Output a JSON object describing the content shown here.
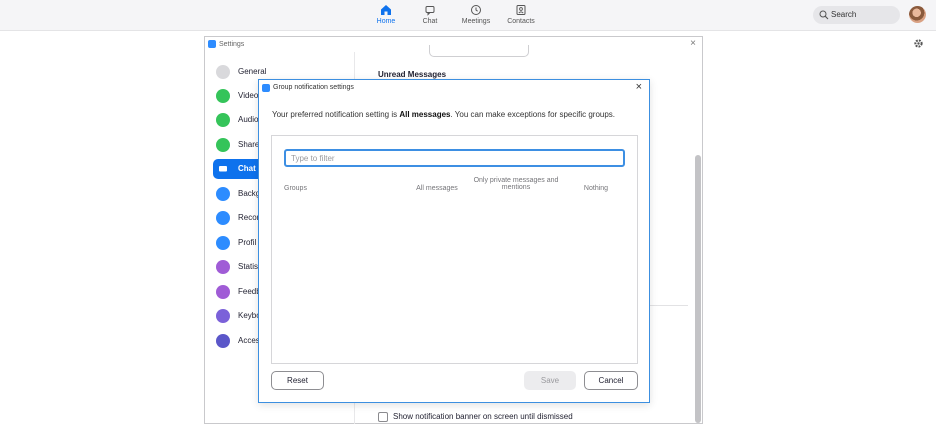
{
  "topnav": {
    "items": [
      {
        "label": "Home",
        "icon": "home-icon",
        "active": true
      },
      {
        "label": "Chat",
        "icon": "chat-bubble-icon",
        "active": false
      },
      {
        "label": "Meetings",
        "icon": "clock-icon",
        "active": false
      },
      {
        "label": "Contacts",
        "icon": "contacts-icon",
        "active": false
      }
    ],
    "search_label": "Search",
    "accent": "#0e72ed"
  },
  "settings": {
    "title": "Settings",
    "sidebar": [
      {
        "label": "General",
        "color": "#d9d9dc"
      },
      {
        "label": "Video",
        "color": "#35c45a"
      },
      {
        "label": "Audio",
        "color": "#35c45a"
      },
      {
        "label": "Share",
        "color": "#35c45a"
      },
      {
        "label": "Chat",
        "color": "#0e72ed",
        "active": true
      },
      {
        "label": "Backg",
        "color": "#2d8cff"
      },
      {
        "label": "Recor",
        "color": "#2d8cff"
      },
      {
        "label": "Profil",
        "color": "#2d8cff"
      },
      {
        "label": "Statis",
        "color": "#a05cd6"
      },
      {
        "label": "Feedb",
        "color": "#a05cd6"
      },
      {
        "label": "Keybo",
        "color": "#7b61d9"
      },
      {
        "label": "Acces",
        "color": "#5b57c9"
      }
    ],
    "unread_heading": "Unread Messages",
    "banner_checkbox_label": "Show notification banner on screen until dismissed"
  },
  "dialog": {
    "title": "Group notification settings",
    "desc_prefix": "Your preferred notification setting is ",
    "desc_bold": "All messages",
    "desc_suffix": ". You can make exceptions for specific groups.",
    "filter_placeholder": "Type to filter",
    "columns": {
      "groups": "Groups",
      "all": "All messages",
      "private": "Only private messages and mentions",
      "nothing": "Nothing"
    },
    "buttons": {
      "reset": "Reset",
      "save": "Save",
      "cancel": "Cancel"
    }
  }
}
